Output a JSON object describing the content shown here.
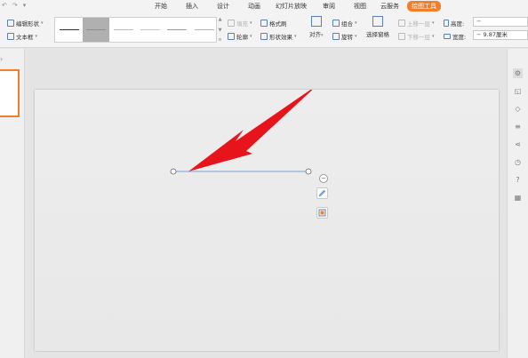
{
  "menubar": {
    "tabs": [
      {
        "label": "开始"
      },
      {
        "label": "插入"
      },
      {
        "label": "设计"
      },
      {
        "label": "动画"
      },
      {
        "label": "幻灯片放映"
      },
      {
        "label": "审阅"
      },
      {
        "label": "视图"
      },
      {
        "label": "云服务"
      },
      {
        "label": "绘图工具",
        "active": true
      }
    ]
  },
  "ribbon": {
    "edit_shape": "编辑形状",
    "text_box": "文本框",
    "fill": "填充",
    "format_painter": "格式刷",
    "outline": "轮廓",
    "shape_effects": "形状效果",
    "align": "对齐",
    "group": "组合",
    "rotate": "旋转",
    "selection_pane": "选择窗格",
    "bring_forward": "上移一层",
    "send_backward": "下移一层",
    "height_label": "高度:",
    "height_value": "",
    "width_label": "宽度:",
    "width_value": "9.87厘米",
    "line_styles": [
      {
        "color": "#333333",
        "selected": false
      },
      {
        "color": "#6f8fd0",
        "selected": true
      },
      {
        "color": "#a8c8a8",
        "selected": false
      },
      {
        "color": "#e6c86e",
        "selected": false
      },
      {
        "color": "#7a9fd6",
        "selected": false
      },
      {
        "color": "#8ccf7e",
        "selected": false
      }
    ]
  },
  "slide": {
    "line_color": "#7a9fd6",
    "arrow_color": "#e8141b"
  },
  "colors": {
    "accent": "#f07e2a"
  }
}
